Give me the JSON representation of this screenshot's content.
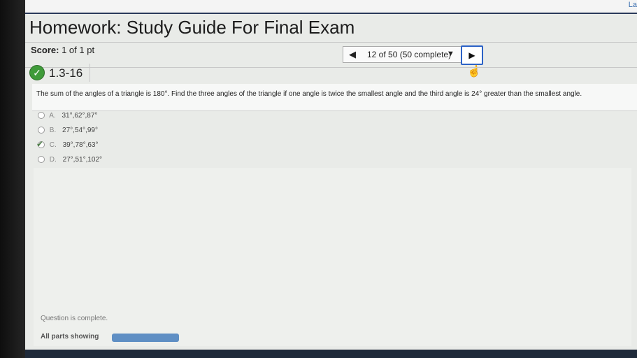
{
  "topbar": {
    "corner_text": "La"
  },
  "header": {
    "title": "Homework: Study Guide For Final Exam"
  },
  "score": {
    "label": "Score:",
    "value": "1 of 1 pt"
  },
  "navigation": {
    "prev_symbol": "◀",
    "position": "12 of 50 (50 complete)",
    "dropdown_symbol": "▼",
    "next_symbol": "▶"
  },
  "question": {
    "id": "1.3-16",
    "text": "The sum of the angles of a triangle is 180°. Find the three angles of the triangle if one angle is twice the smallest angle and the third angle is 24° greater than the smallest angle.",
    "options": [
      {
        "letter": "A.",
        "value": "31°,62°,87°"
      },
      {
        "letter": "B.",
        "value": "27°,54°,99°"
      },
      {
        "letter": "C.",
        "value": "39°,78°,63°"
      },
      {
        "letter": "D.",
        "value": "27°,51°,102°"
      }
    ]
  },
  "footer": {
    "status": "Question is complete.",
    "parts": "All parts showing"
  },
  "colors": {
    "accent": "#2c62c6",
    "check": "#3f9b39",
    "progress": "#5f8fc4"
  }
}
